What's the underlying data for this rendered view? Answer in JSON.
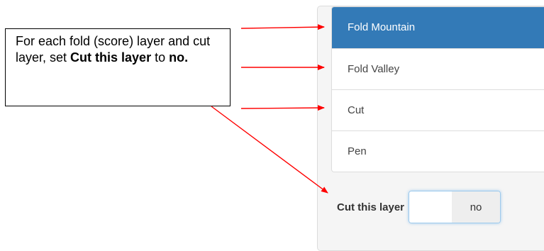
{
  "layers": [
    {
      "label": "Fold Mountain",
      "selected": true
    },
    {
      "label": "Fold Valley",
      "selected": false
    },
    {
      "label": "Cut",
      "selected": false
    },
    {
      "label": "Pen",
      "selected": false
    }
  ],
  "cut_setting": {
    "label": "Cut this layer",
    "value": "no"
  },
  "callout": {
    "text_before": "For each fold (score) layer and cut layer, set ",
    "bold1": "Cut this layer",
    "text_mid": " to ",
    "bold2": "no."
  },
  "colors": {
    "accent": "#337ab7",
    "arrow": "#ff0000"
  }
}
